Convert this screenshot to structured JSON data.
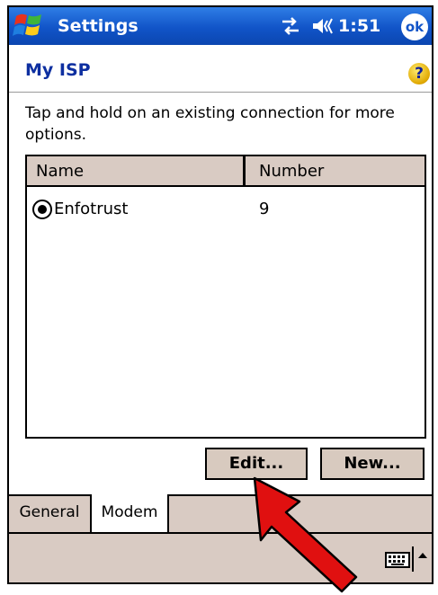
{
  "titlebar": {
    "app_title": "Settings",
    "clock": "1:51",
    "ok_label": "ok",
    "icons": [
      "windows-start-logo",
      "connectivity-icon",
      "speaker-icon"
    ]
  },
  "header": {
    "title": "My ISP",
    "help_label": "?"
  },
  "instruction": "Tap and hold on an existing connection for more options.",
  "list": {
    "columns": [
      "Name",
      "Number"
    ],
    "rows": [
      {
        "name": "Enfotrust",
        "number": "9",
        "selected": true
      }
    ]
  },
  "buttons": {
    "edit": "Edit...",
    "new": "New..."
  },
  "tabs": [
    {
      "label": "General",
      "active": false
    },
    {
      "label": "Modem",
      "active": true
    }
  ],
  "annotation": {
    "arrow_color": "#e01010"
  }
}
